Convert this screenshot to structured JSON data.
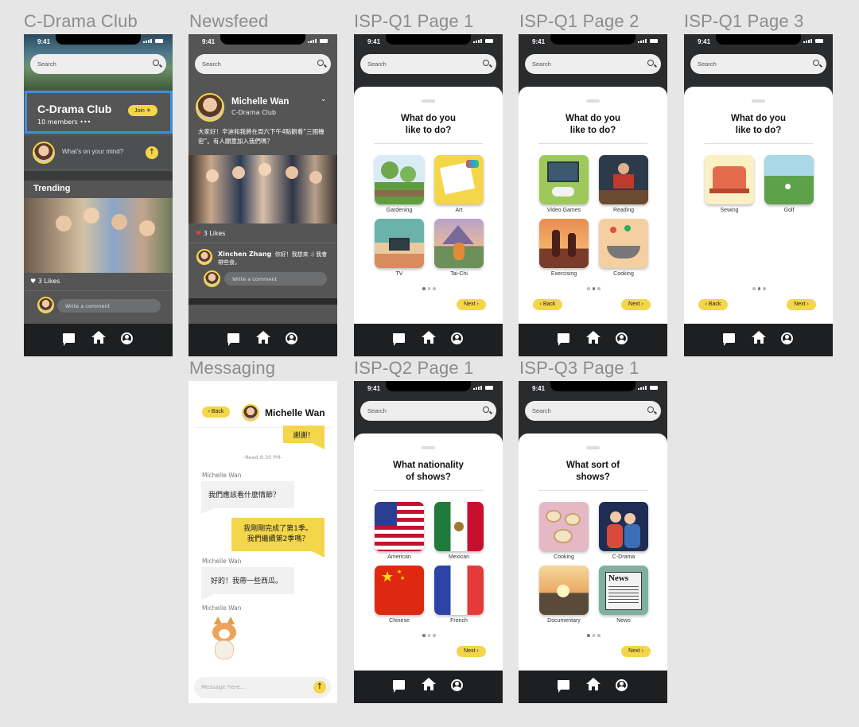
{
  "labels": {
    "club": "C-Drama Club",
    "newsfeed": "Newsfeed",
    "q1p1": "ISP-Q1 Page 1",
    "q1p2": "ISP-Q1 Page 2",
    "q1p3": "ISP-Q1 Page 3",
    "messaging": "Messaging",
    "q2p1": "ISP-Q2 Page 1",
    "q3p1": "ISP-Q3 Page 1"
  },
  "status": {
    "time": "9:41"
  },
  "search": {
    "placeholder": "Search"
  },
  "club": {
    "name": "C-Drama Club",
    "members": "10 members",
    "more": "•••",
    "join": "Join ☀",
    "prompt": "What's on your mind?",
    "trending": "Trending",
    "likes": "3 Likes",
    "comment_placeholder": "Write a comment"
  },
  "newsfeed": {
    "author": "Michelle Wan",
    "group": "C-Drama Club",
    "post": "大家好！辛迪和我將在周六下午4點觀看“三國機密”。有人願意加入我們嗎？",
    "likes": "3 Likes",
    "commenter": "Xinchen Zhang",
    "comment": "你好！我想來 :) 我會帶些食。",
    "comment_placeholder": "Write a comment"
  },
  "q1": {
    "title_line1": "What do you",
    "title_line2": "like to do?",
    "page1": [
      "Gardening",
      "Art",
      "TV",
      "Tai-Chi"
    ],
    "page2": [
      "Video Games",
      "Reading",
      "Exercising",
      "Cooking"
    ],
    "page3": [
      "Sewing",
      "Golf"
    ]
  },
  "q2": {
    "title_line1": "What nationality",
    "title_line2": "of shows?",
    "options": [
      "American",
      "Mexican",
      "Chinese",
      "French"
    ]
  },
  "q3": {
    "title_line1": "What sort of",
    "title_line2": "shows?",
    "options": [
      "Cooking",
      "C-Drama",
      "Documentary",
      "News"
    ]
  },
  "nav": {
    "next": "Next ›",
    "back": "‹ Back"
  },
  "messaging": {
    "back": "‹ Back",
    "contact": "Michelle Wan",
    "msg1": "謝謝！",
    "read": "-Read 8:30 PM-",
    "sender": "Michelle Wan",
    "msg2": "我們應該看什麼情節？",
    "msg3_line1": "我剛剛完成了第1季。",
    "msg3_line2": "我們繼續第2季嗎？",
    "msg4": "好的！我帶一些西瓜。",
    "input_placeholder": "Message here..."
  },
  "colors": {
    "accent": "#f4d64a",
    "dark": "#2a2b2d",
    "selection": "#3d8fe0"
  }
}
